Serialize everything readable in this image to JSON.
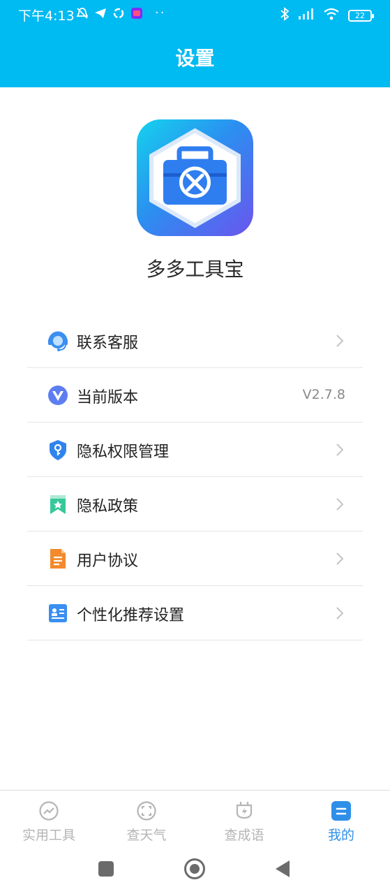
{
  "status_bar": {
    "time": "下午4:13",
    "dots": "··",
    "battery": "22",
    "icons": [
      "mute-bell-icon",
      "telegram-icon",
      "sync-icon",
      "app-badge-icon",
      "bluetooth-icon",
      "signal-icon",
      "wifi-icon",
      "battery-icon"
    ]
  },
  "header": {
    "title": "设置"
  },
  "app": {
    "name": "多多工具宝",
    "logo_icon": "toolbox-icon"
  },
  "menu": {
    "items": [
      {
        "label": "联系客服",
        "icon": "customer-service-icon",
        "value": ""
      },
      {
        "label": "当前版本",
        "icon": "version-icon",
        "value": "V2.7.8"
      },
      {
        "label": "隐私权限管理",
        "icon": "shield-key-icon",
        "value": ""
      },
      {
        "label": "隐私政策",
        "icon": "bookmark-star-icon",
        "value": ""
      },
      {
        "label": "用户协议",
        "icon": "document-icon",
        "value": ""
      },
      {
        "label": "个性化推荐设置",
        "icon": "profile-card-icon",
        "value": ""
      }
    ]
  },
  "tabbar": {
    "tabs": [
      {
        "label": "实用工具",
        "icon": "tools-chart-icon",
        "active": false
      },
      {
        "label": "查天气",
        "icon": "weather-scan-icon",
        "active": false
      },
      {
        "label": "查成语",
        "icon": "idiom-plug-icon",
        "active": false
      },
      {
        "label": "我的",
        "icon": "mine-icon",
        "active": true
      }
    ]
  },
  "colors": {
    "header_bg": "#00baf2",
    "active_tab": "#2e8fe8",
    "inactive_tab": "#b5b5b5"
  }
}
